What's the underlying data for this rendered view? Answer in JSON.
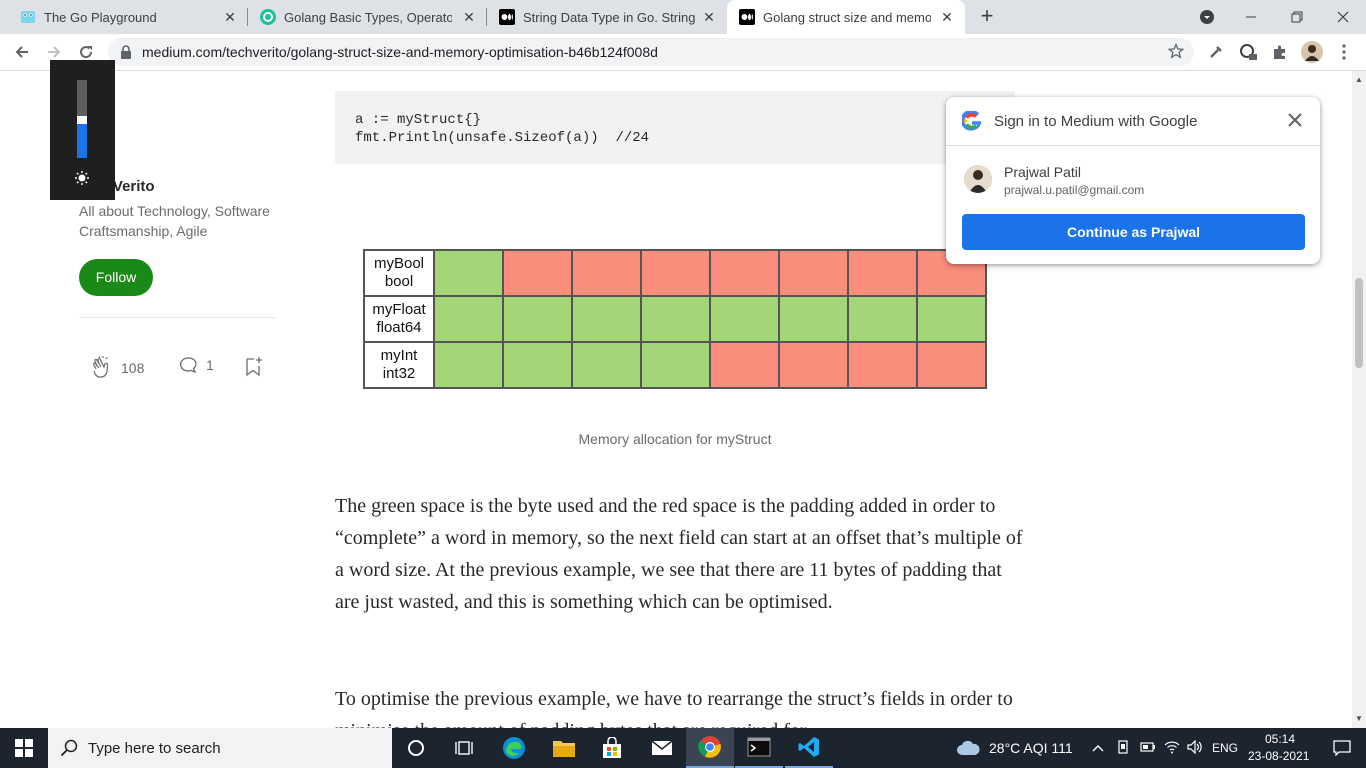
{
  "browser": {
    "tabs": [
      {
        "title": "The Go Playground",
        "active": false
      },
      {
        "title": "Golang Basic Types, Operators ar",
        "active": false
      },
      {
        "title": "String Data Type in Go. Strings in",
        "active": false
      },
      {
        "title": "Golang struct size and memory o",
        "active": true
      }
    ],
    "new_tab": "+",
    "url": "medium.com/techverito/golang-struct-size-and-memory-optimisation-b46b124f008d"
  },
  "sidebar": {
    "publication_name": "TechVerito",
    "publication_desc": "All about Technology, Software Craftsmanship, Agile",
    "follow_label": "Follow",
    "claps": "108",
    "responses": "1"
  },
  "article": {
    "code_lines": [
      "a := myStruct{}",
      "fmt.Println(unsafe.Sizeof(a))  //24"
    ],
    "table": {
      "rows": [
        {
          "label1": "myBool",
          "label2": "bool",
          "cells": [
            "g",
            "r",
            "r",
            "r",
            "r",
            "r",
            "r",
            "r"
          ]
        },
        {
          "label1": "myFloat",
          "label2": "float64",
          "cells": [
            "g",
            "g",
            "g",
            "g",
            "g",
            "g",
            "g",
            "g"
          ]
        },
        {
          "label1": "myInt",
          "label2": "int32",
          "cells": [
            "g",
            "g",
            "g",
            "g",
            "r",
            "r",
            "r",
            "r"
          ]
        }
      ]
    },
    "caption": "Memory allocation for myStruct",
    "paragraph1": "The green space is the byte used and the red space is the padding added in order to “complete” a word in memory, so the next field can start at an offset that’s multiple of a word size. At the previous example, we see that there are 11 bytes of padding that are just wasted, and this is something which can be optimised.",
    "paragraph2": "To optimise the previous example, we have to rearrange the struct’s fields in order to minimise the amount of padding bytes that are required for"
  },
  "google_popup": {
    "title": "Sign in to Medium with Google",
    "name": "Prajwal Patil",
    "email": "prajwal.u.patil@gmail.com",
    "continue_label": "Continue as Prajwal"
  },
  "taskbar": {
    "search_placeholder": "Type here to search",
    "weather": "28°C  AQI 111",
    "language": "ENG",
    "time": "05:14",
    "date": "23-08-2021"
  },
  "colors": {
    "green": "#a3d677",
    "red": "#fa8d7c",
    "follow": "#1a8917",
    "google_blue": "#1a73e8"
  }
}
